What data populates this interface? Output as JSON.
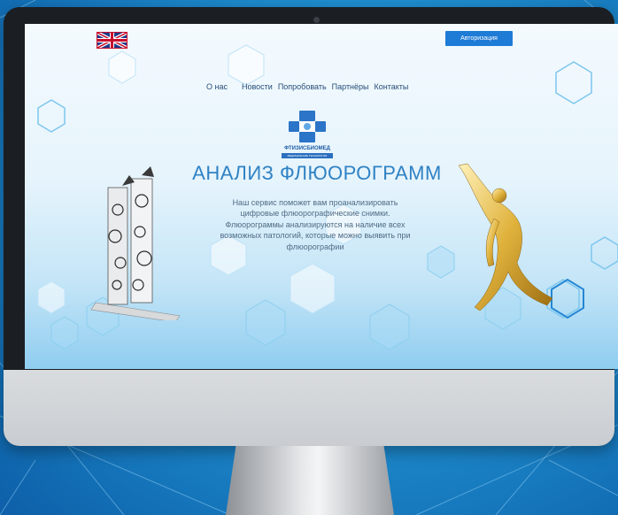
{
  "header": {
    "language_flag": "uk-flag-icon",
    "auth_button": "Авторизация"
  },
  "nav": {
    "items": [
      "О нас",
      "Новости",
      "Попробовать",
      "Партнёры",
      "Контакты"
    ]
  },
  "logo": {
    "name": "ФТИЗИСБИОМЕД",
    "subtitle": "МЕДИЦИНСКИЕ ТЕХНОЛОГИИ"
  },
  "hero": {
    "title": "АНАЛИЗ ФЛЮОРОГРАММ",
    "description": "Наш сервис поможет вам проанализировать цифровые флюорографические снимки. Флюорограммы анализируются на наличие всех возможных патологий, которые можно выявить при флюорографии"
  },
  "colors": {
    "accent": "#1e7bd6",
    "title": "#2f82c4"
  }
}
